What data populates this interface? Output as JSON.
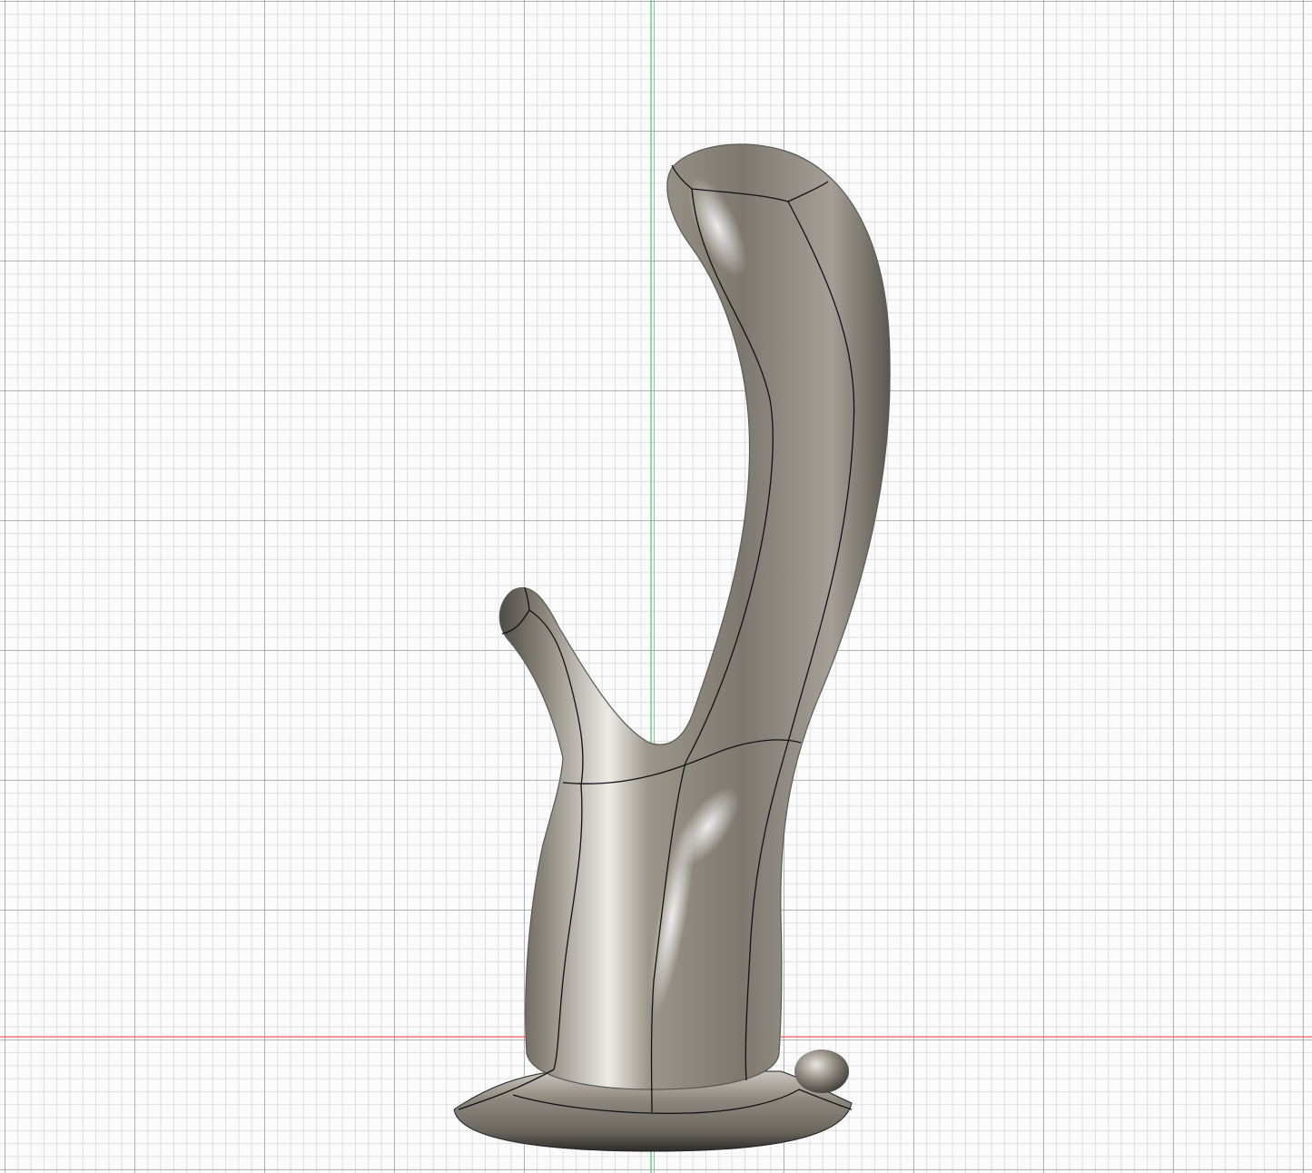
{
  "viewport": {
    "background": "#fbfbfb",
    "grid_major_color": "#8c8c8c",
    "grid_minor_color": "#bebebe",
    "axis_y_color": "#39d353",
    "axis_x_color": "#ff5a5a"
  },
  "model": {
    "name": "curved-sculpt-body",
    "material_color": "#8a857b",
    "edge_color": "#111111"
  }
}
